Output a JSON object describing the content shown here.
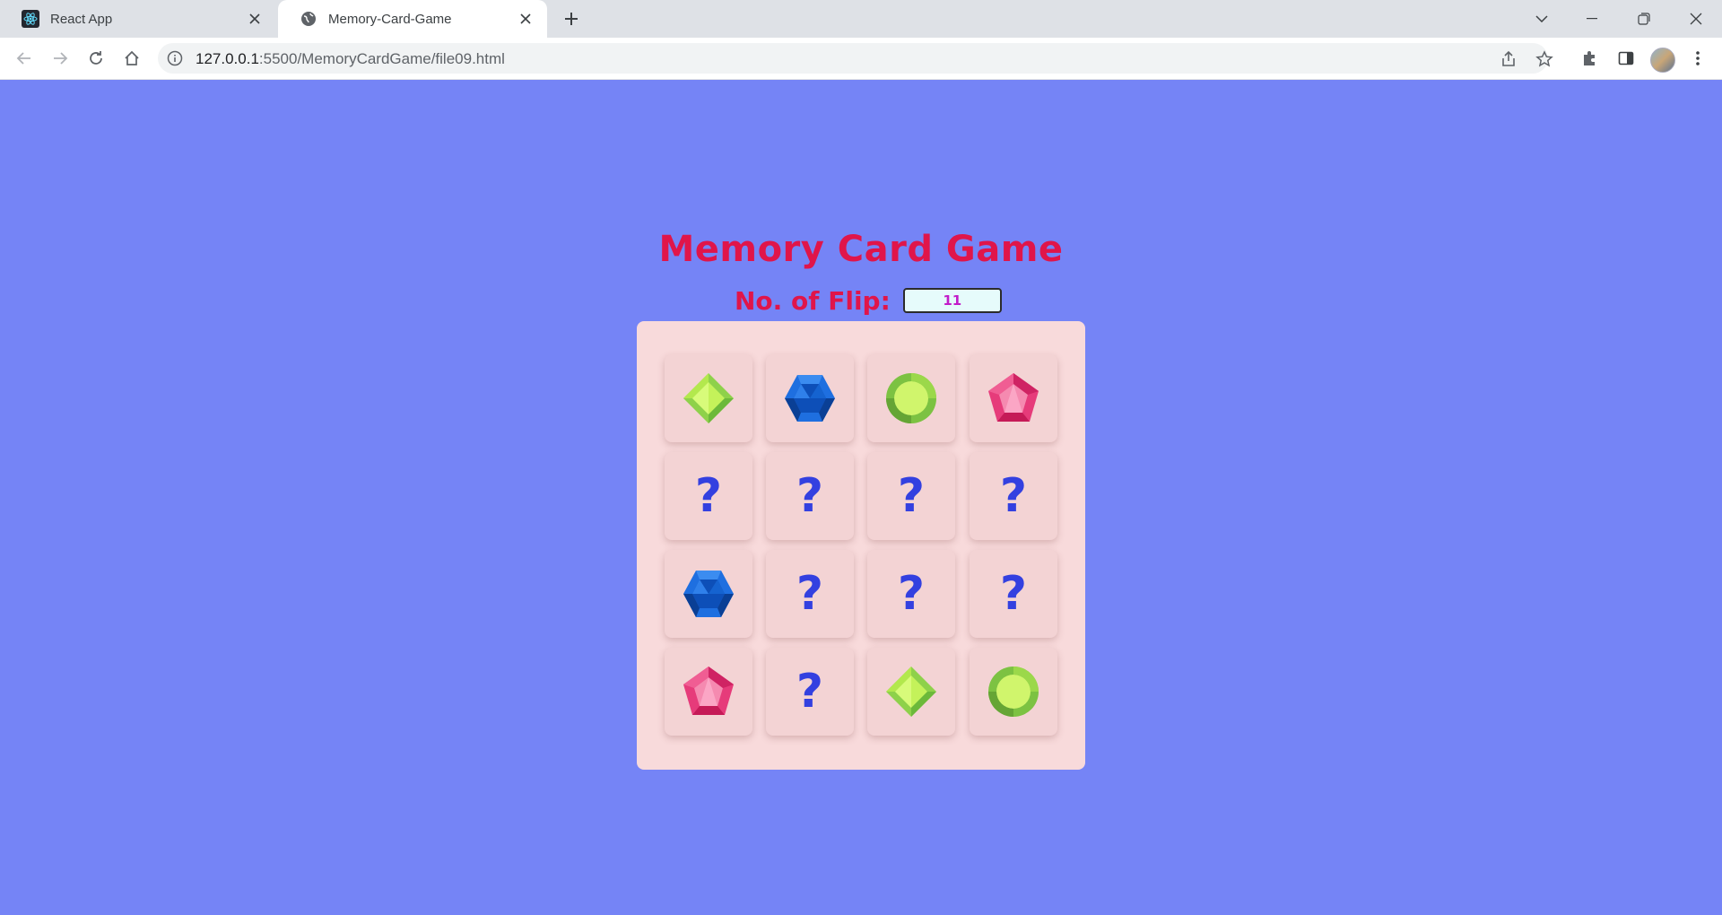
{
  "browser": {
    "tabs": [
      {
        "title": "React App",
        "active": false,
        "icon": "react-icon"
      },
      {
        "title": "Memory-Card-Game",
        "active": true,
        "icon": "globe-icon"
      }
    ],
    "url_host": "127.0.0.1",
    "url_rest": ":5500/MemoryCardGame/file09.html"
  },
  "game": {
    "title": "Memory Card Game",
    "flip_label": "No. of Flip:",
    "flip_count": "11",
    "colors": {
      "background": "#7584f6",
      "title": "#e0154a",
      "board": "#f8dadb",
      "card": "#f3d3d4",
      "question_mark": "#3340e0",
      "count_text": "#c21cc9"
    },
    "cards": [
      {
        "face": "green-diamond-gem"
      },
      {
        "face": "blue-hexagon-gem"
      },
      {
        "face": "lime-round-gem"
      },
      {
        "face": "pink-pentagon-gem"
      },
      {
        "face": "?"
      },
      {
        "face": "?"
      },
      {
        "face": "?"
      },
      {
        "face": "?"
      },
      {
        "face": "blue-hexagon-gem"
      },
      {
        "face": "?"
      },
      {
        "face": "?"
      },
      {
        "face": "?"
      },
      {
        "face": "pink-pentagon-gem"
      },
      {
        "face": "?"
      },
      {
        "face": "green-diamond-gem"
      },
      {
        "face": "lime-round-gem"
      }
    ]
  }
}
